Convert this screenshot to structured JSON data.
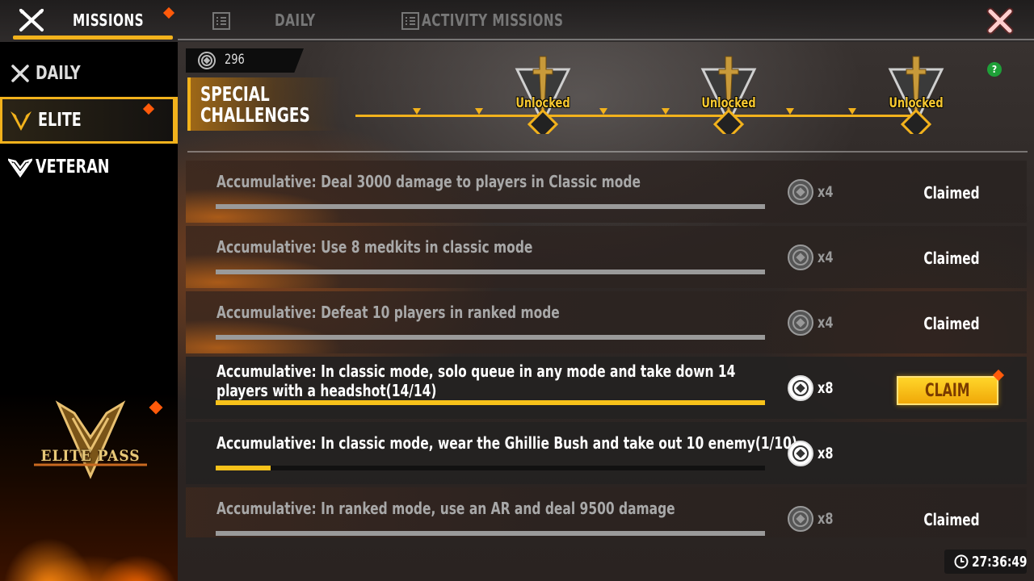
{
  "topbar": {
    "tabs": [
      {
        "label": "MISSIONS",
        "active": true
      },
      {
        "label": "DAILY",
        "active": false
      },
      {
        "label": "ACTIVITY MISSIONS",
        "active": false
      }
    ]
  },
  "sidebar": {
    "items": [
      {
        "label": "DAILY",
        "icon": "crossed-swords-icon"
      },
      {
        "label": "ELITE",
        "icon": "elite-wings-icon",
        "selected": true
      },
      {
        "label": "VETERAN",
        "icon": "veteran-wings-icon"
      }
    ],
    "elite_pass_label": "ELITE PASS"
  },
  "header": {
    "coins": "296",
    "special_title_line1": "SPECIAL",
    "special_title_line2": "CHALLENGES",
    "help": "?"
  },
  "milestones": [
    {
      "label": "Unlocked"
    },
    {
      "label": "Unlocked"
    },
    {
      "label": "Unlocked"
    }
  ],
  "missions": [
    {
      "desc": "Accumulative: Deal 3000 damage to players in Classic mode",
      "reward": "x4",
      "status": "Claimed",
      "progress": 1.0
    },
    {
      "desc": "Accumulative: Use 8 medkits in classic mode",
      "reward": "x4",
      "status": "Claimed",
      "progress": 1.0
    },
    {
      "desc": "Accumulative: Defeat 10 players in ranked mode",
      "reward": "x4",
      "status": "Claimed",
      "progress": 1.0
    },
    {
      "desc": "Accumulative: In classic mode, solo queue in any mode and take down 14 players with a headshot(14/14)",
      "reward": "x8",
      "status": "CLAIM",
      "progress": 1.0
    },
    {
      "desc": "Accumulative: In classic mode, wear the Ghillie Bush and take out 10 enemy(1/10)",
      "reward": "x8",
      "status": "",
      "progress": 0.1
    },
    {
      "desc": "Accumulative: In ranked mode, use an AR and deal 9500 damage",
      "reward": "x8",
      "status": "Claimed",
      "progress": 1.0
    }
  ],
  "timer": "27:36:49",
  "colors": {
    "accent": "#f2b21c",
    "notify": "#ff5a0a",
    "help": "#1ea038"
  }
}
